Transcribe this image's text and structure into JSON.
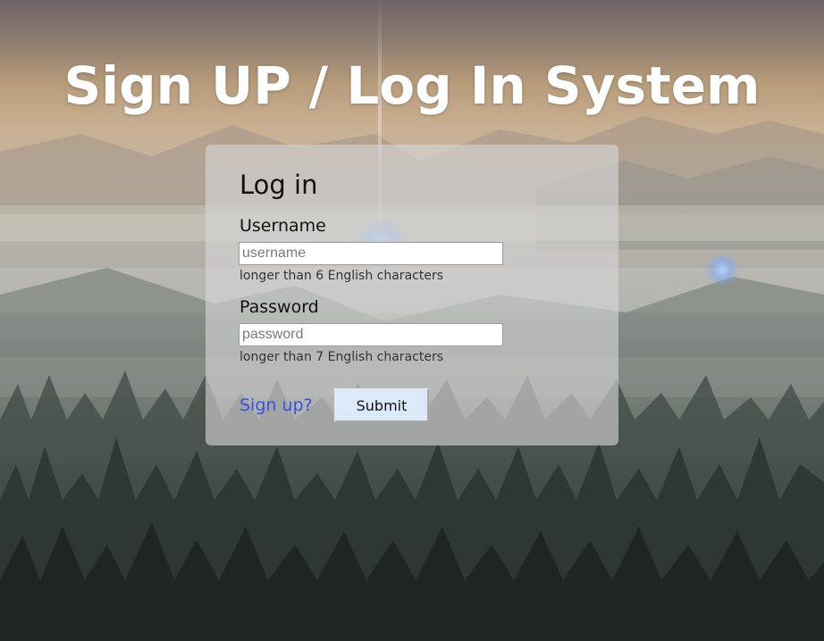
{
  "page": {
    "title": "Sign UP / Log In System"
  },
  "login_card": {
    "heading": "Log in",
    "username": {
      "label": "Username",
      "value": "",
      "placeholder": "username",
      "hint": "longer than 6 English characters"
    },
    "password": {
      "label": "Password",
      "value": "",
      "placeholder": "password",
      "hint": "longer than 7 English characters"
    },
    "signup_link_label": "Sign up?",
    "submit_label": "Submit"
  },
  "colors": {
    "link": "#3a50e0",
    "submit_background": "#dbe9f8",
    "title_text": "#ffffff"
  }
}
